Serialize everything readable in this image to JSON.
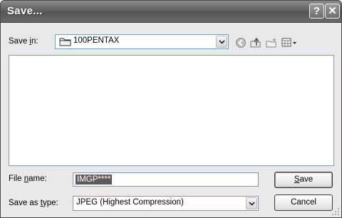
{
  "window": {
    "title": "Save...",
    "help_glyph": "?",
    "close_glyph": "✕"
  },
  "save_in": {
    "label": "Save in:",
    "mnemonic": "i",
    "folder": "100PENTAX",
    "folder_icon": "folder-icon",
    "toolbar_icons": [
      "back-icon",
      "up-folder-icon",
      "new-folder-icon",
      "view-menu-icon"
    ]
  },
  "file_name": {
    "label": "File name:",
    "mnemonic": "n",
    "value": "IMGP****"
  },
  "save_as_type": {
    "label": "Save as type:",
    "mnemonic": "t",
    "value": "JPEG (Highest Compression)"
  },
  "buttons": {
    "save": "Save",
    "cancel": "Cancel"
  }
}
